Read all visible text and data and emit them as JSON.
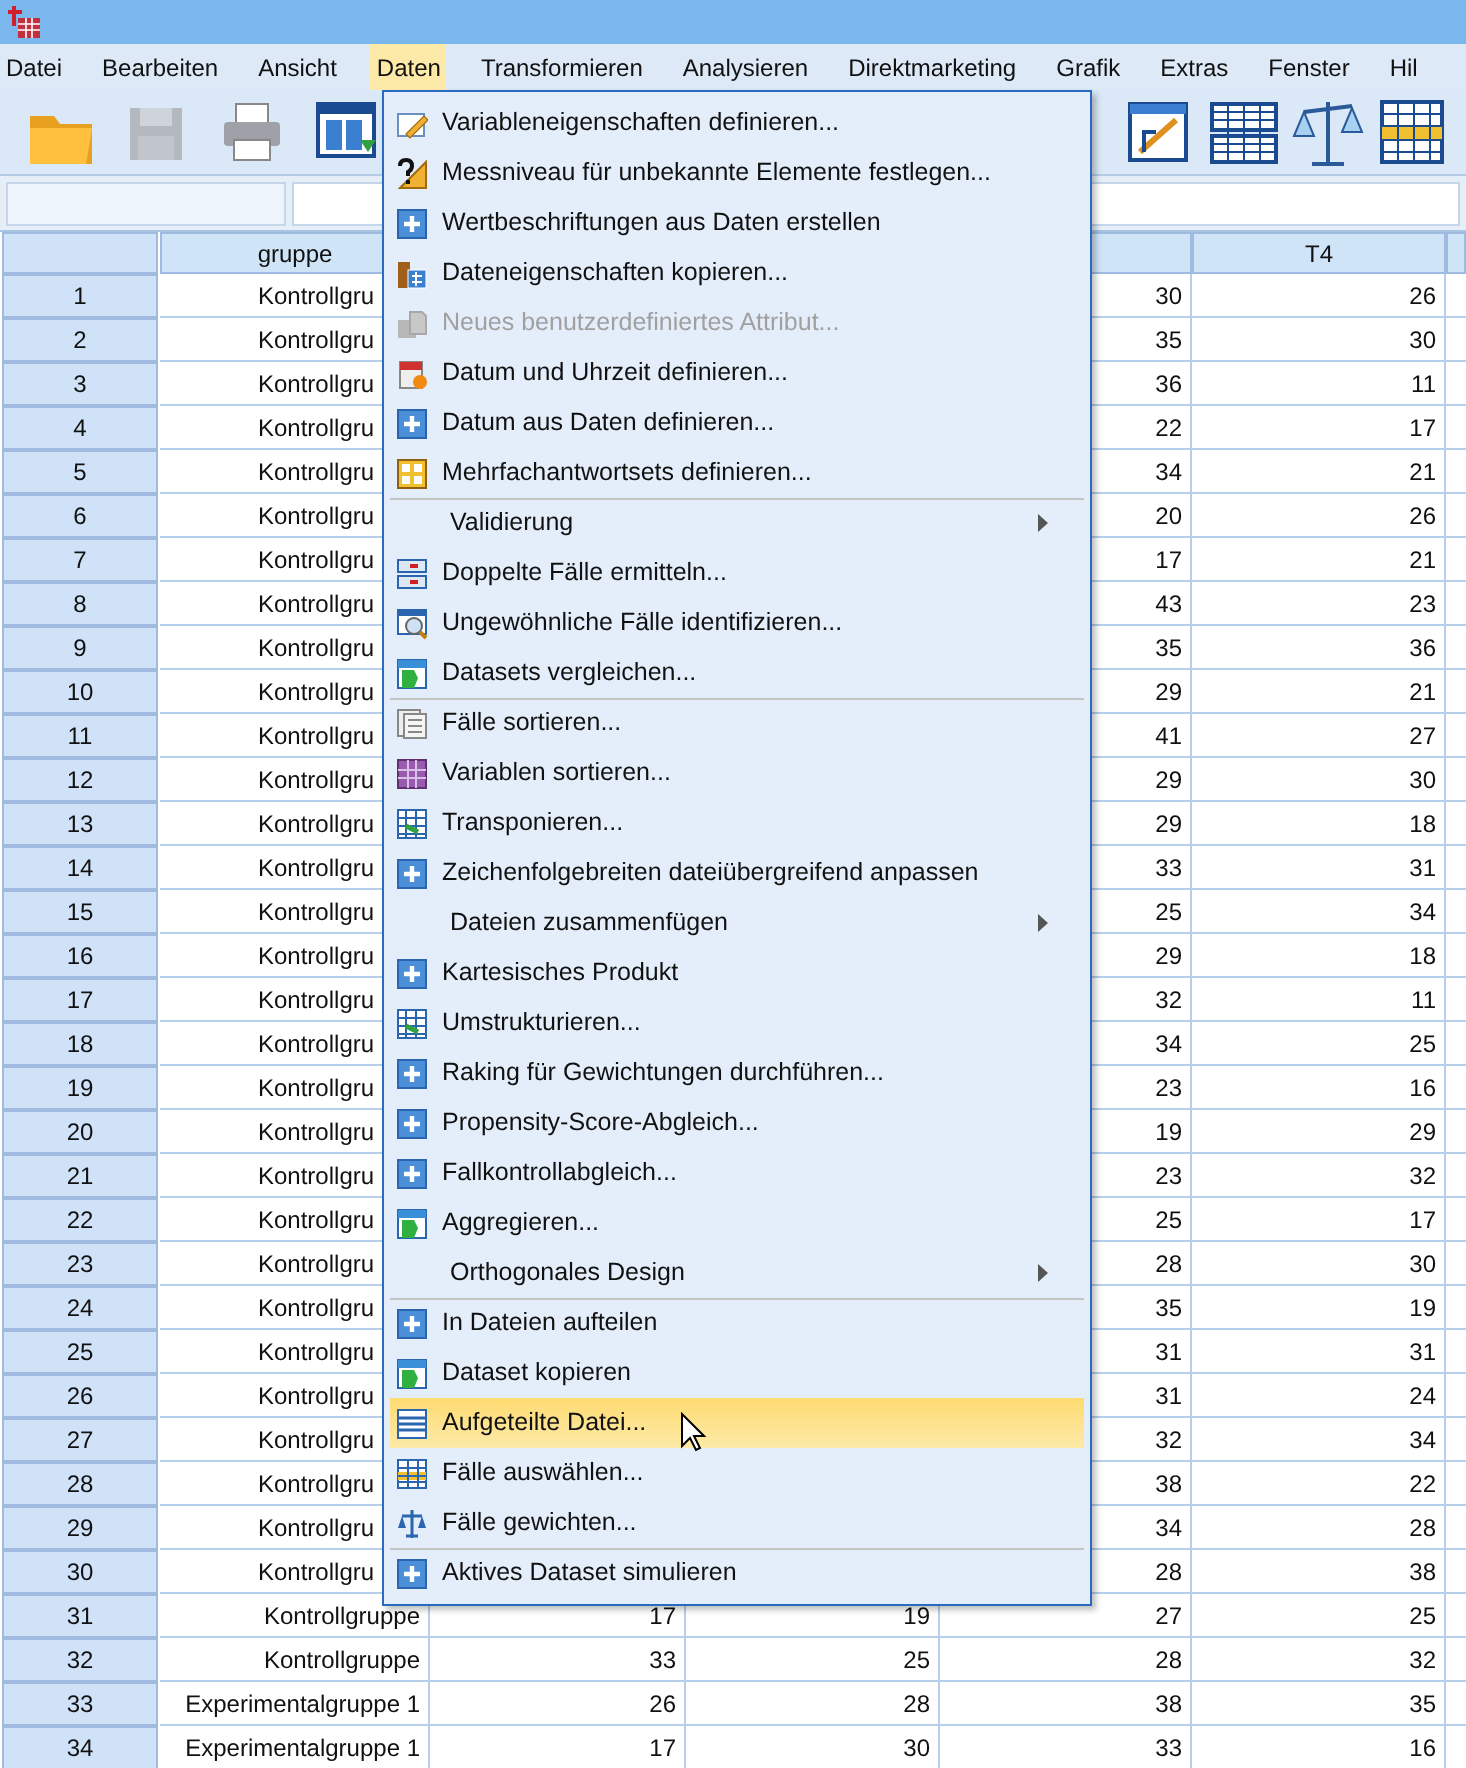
{
  "menubar": [
    {
      "label": "Datei",
      "selected": false
    },
    {
      "label": "Bearbeiten",
      "selected": false
    },
    {
      "label": "Ansicht",
      "selected": false
    },
    {
      "label": "Daten",
      "selected": true
    },
    {
      "label": "Transformieren",
      "selected": false
    },
    {
      "label": "Analysieren",
      "selected": false
    },
    {
      "label": "Direktmarketing",
      "selected": false
    },
    {
      "label": "Grafik",
      "selected": false
    },
    {
      "label": "Extras",
      "selected": false
    },
    {
      "label": "Fenster",
      "selected": false
    },
    {
      "label": "Hil",
      "selected": false
    }
  ],
  "toolbar": [
    {
      "disabled": false
    },
    {
      "disabled": true
    },
    {
      "disabled": false
    },
    {
      "disabled": false
    },
    {
      "disabled": false
    },
    {
      "disabled": false
    },
    {
      "disabled": false
    },
    {
      "disabled": false
    }
  ],
  "table": {
    "columns": {
      "column_1": "gruppe",
      "column_5": "T4"
    },
    "rows": [
      {
        "num": "1",
        "column_1": "Kontrollgru",
        "column_4": "30",
        "column_5": "26"
      },
      {
        "num": "2",
        "column_1": "Kontrollgru",
        "column_4": "35",
        "column_5": "30"
      },
      {
        "num": "3",
        "column_1": "Kontrollgru",
        "column_4": "36",
        "column_5": "11"
      },
      {
        "num": "4",
        "column_1": "Kontrollgru",
        "column_4": "22",
        "column_5": "17"
      },
      {
        "num": "5",
        "column_1": "Kontrollgru",
        "column_4": "34",
        "column_5": "21"
      },
      {
        "num": "6",
        "column_1": "Kontrollgru",
        "column_4": "20",
        "column_5": "26"
      },
      {
        "num": "7",
        "column_1": "Kontrollgru",
        "column_4": "17",
        "column_5": "21"
      },
      {
        "num": "8",
        "column_1": "Kontrollgru",
        "column_4": "43",
        "column_5": "23"
      },
      {
        "num": "9",
        "column_1": "Kontrollgru",
        "column_4": "35",
        "column_5": "36"
      },
      {
        "num": "10",
        "column_1": "Kontrollgru",
        "column_4": "29",
        "column_5": "21"
      },
      {
        "num": "11",
        "column_1": "Kontrollgru",
        "column_4": "41",
        "column_5": "27"
      },
      {
        "num": "12",
        "column_1": "Kontrollgru",
        "column_4": "29",
        "column_5": "30"
      },
      {
        "num": "13",
        "column_1": "Kontrollgru",
        "column_4": "29",
        "column_5": "18"
      },
      {
        "num": "14",
        "column_1": "Kontrollgru",
        "column_4": "33",
        "column_5": "31"
      },
      {
        "num": "15",
        "column_1": "Kontrollgru",
        "column_4": "25",
        "column_5": "34"
      },
      {
        "num": "16",
        "column_1": "Kontrollgru",
        "column_4": "29",
        "column_5": "18"
      },
      {
        "num": "17",
        "column_1": "Kontrollgru",
        "column_4": "32",
        "column_5": "11"
      },
      {
        "num": "18",
        "column_1": "Kontrollgru",
        "column_4": "34",
        "column_5": "25"
      },
      {
        "num": "19",
        "column_1": "Kontrollgru",
        "column_4": "23",
        "column_5": "16"
      },
      {
        "num": "20",
        "column_1": "Kontrollgru",
        "column_4": "19",
        "column_5": "29"
      },
      {
        "num": "21",
        "column_1": "Kontrollgru",
        "column_4": "23",
        "column_5": "32"
      },
      {
        "num": "22",
        "column_1": "Kontrollgru",
        "column_4": "25",
        "column_5": "17"
      },
      {
        "num": "23",
        "column_1": "Kontrollgru",
        "column_4": "28",
        "column_5": "30"
      },
      {
        "num": "24",
        "column_1": "Kontrollgru",
        "column_4": "35",
        "column_5": "19"
      },
      {
        "num": "25",
        "column_1": "Kontrollgru",
        "column_4": "31",
        "column_5": "31"
      },
      {
        "num": "26",
        "column_1": "Kontrollgru",
        "column_4": "31",
        "column_5": "24"
      },
      {
        "num": "27",
        "column_1": "Kontrollgru",
        "column_4": "32",
        "column_5": "34"
      },
      {
        "num": "28",
        "column_1": "Kontrollgru",
        "column_4": "38",
        "column_5": "22"
      },
      {
        "num": "29",
        "column_1": "Kontrollgru",
        "column_4": "34",
        "column_5": "28"
      },
      {
        "num": "30",
        "column_1": "Kontrollgru",
        "column_4": "28",
        "column_5": "38"
      },
      {
        "num": "31",
        "column_1": "Kontrollgruppe",
        "column_2": "17",
        "column_3": "19",
        "column_4": "27",
        "column_5": "25"
      },
      {
        "num": "32",
        "column_1": "Kontrollgruppe",
        "column_2": "33",
        "column_3": "25",
        "column_4": "28",
        "column_5": "32"
      },
      {
        "num": "33",
        "column_1": "Experimentalgruppe 1",
        "column_2": "26",
        "column_3": "28",
        "column_4": "38",
        "column_5": "35"
      },
      {
        "num": "34",
        "column_1": "Experimentalgruppe 1",
        "column_2": "17",
        "column_3": "30",
        "column_4": "33",
        "column_5": "16"
      }
    ]
  },
  "menu": [
    {
      "kind": "item",
      "label": "Variableneigenschaften definieren...",
      "selected": false,
      "disabled": false
    },
    {
      "kind": "item",
      "label": "Messniveau für unbekannte Elemente festlegen...",
      "selected": false,
      "disabled": false
    },
    {
      "kind": "item",
      "label": "Wertbeschriftungen aus Daten erstellen",
      "selected": false,
      "disabled": false
    },
    {
      "kind": "item",
      "label": "Dateneigenschaften kopieren...",
      "selected": false,
      "disabled": false
    },
    {
      "kind": "item",
      "label": "Neues benutzerdefiniertes Attribut...",
      "selected": false,
      "disabled": true
    },
    {
      "kind": "item",
      "label": "Datum und Uhrzeit definieren...",
      "selected": false,
      "disabled": false
    },
    {
      "kind": "item",
      "label": "Datum aus Daten definieren...",
      "selected": false,
      "disabled": false
    },
    {
      "kind": "item",
      "label": "Mehrfachantwortsets definieren...",
      "selected": false,
      "disabled": false
    },
    {
      "kind": "separator"
    },
    {
      "kind": "submenu",
      "label": "Validierung",
      "selected": false,
      "disabled": false
    },
    {
      "kind": "item",
      "label": "Doppelte Fälle ermitteln...",
      "selected": false,
      "disabled": false
    },
    {
      "kind": "item",
      "label": "Ungewöhnliche Fälle identifizieren...",
      "selected": false,
      "disabled": false
    },
    {
      "kind": "item",
      "label": "Datasets vergleichen...",
      "selected": false,
      "disabled": false
    },
    {
      "kind": "separator"
    },
    {
      "kind": "item",
      "label": "Fälle sortieren...",
      "selected": false,
      "disabled": false
    },
    {
      "kind": "item",
      "label": "Variablen sortieren...",
      "selected": false,
      "disabled": false
    },
    {
      "kind": "item",
      "label": "Transponieren...",
      "selected": false,
      "disabled": false
    },
    {
      "kind": "item",
      "label": "Zeichenfolgebreiten dateiübergreifend anpassen",
      "selected": false,
      "disabled": false
    },
    {
      "kind": "submenu",
      "label": "Dateien zusammenfügen",
      "selected": false,
      "disabled": false
    },
    {
      "kind": "item",
      "label": "Kartesisches Produkt",
      "selected": false,
      "disabled": false
    },
    {
      "kind": "item",
      "label": "Umstrukturieren...",
      "selected": false,
      "disabled": false
    },
    {
      "kind": "item",
      "label": "Raking für Gewichtungen durchführen...",
      "selected": false,
      "disabled": false
    },
    {
      "kind": "item",
      "label": "Propensity-Score-Abgleich...",
      "selected": false,
      "disabled": false
    },
    {
      "kind": "item",
      "label": "Fallkontrollabgleich...",
      "selected": false,
      "disabled": false
    },
    {
      "kind": "item",
      "label": "Aggregieren...",
      "selected": false,
      "disabled": false
    },
    {
      "kind": "submenu",
      "label": "Orthogonales Design",
      "selected": false,
      "disabled": false
    },
    {
      "kind": "separator"
    },
    {
      "kind": "item",
      "label": "In Dateien aufteilen",
      "selected": false,
      "disabled": false
    },
    {
      "kind": "item",
      "label": "Dataset kopieren",
      "selected": false,
      "disabled": false
    },
    {
      "kind": "item",
      "label": "Aufgeteilte Datei...",
      "selected": true,
      "disabled": false
    },
    {
      "kind": "item",
      "label": "Fälle auswählen...",
      "selected": false,
      "disabled": false
    },
    {
      "kind": "item",
      "label": "Fälle gewichten...",
      "selected": false,
      "disabled": false
    },
    {
      "kind": "separator"
    },
    {
      "kind": "item",
      "label": "Aktives Dataset simulieren",
      "selected": false,
      "disabled": false
    }
  ]
}
